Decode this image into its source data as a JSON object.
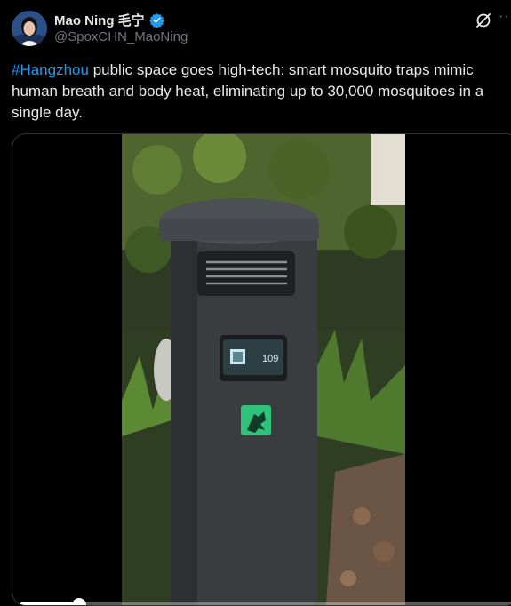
{
  "author": {
    "display_name": "Mao Ning 毛宁",
    "handle": "@SpoxCHN_MaoNing",
    "verified": true,
    "avatar_icon": "person-avatar"
  },
  "header_actions": {
    "grok_icon": "grok-icon",
    "more_label": "···"
  },
  "tweet": {
    "hashtag": "#Hangzhou",
    "text": " public space goes high-tech: smart mosquito traps mimic human breath and body heat, eliminating up to 30,000 mosquitoes in a single day."
  },
  "media": {
    "type": "video",
    "screen_reading": "109",
    "progress": 0.12
  },
  "colors": {
    "background": "#000000",
    "text": "#e7e9ea",
    "secondary_text": "#71767b",
    "link": "#1d9bf0",
    "verified_badge": "#1d9bf0"
  }
}
